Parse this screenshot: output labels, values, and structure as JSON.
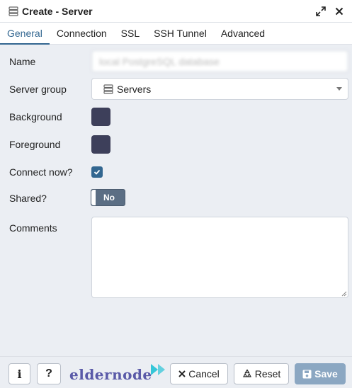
{
  "window": {
    "title": "Create - Server"
  },
  "tabs": [
    {
      "label": "General",
      "active": true
    },
    {
      "label": "Connection",
      "active": false
    },
    {
      "label": "SSL",
      "active": false
    },
    {
      "label": "SSH Tunnel",
      "active": false
    },
    {
      "label": "Advanced",
      "active": false
    }
  ],
  "form": {
    "name": {
      "label": "Name",
      "value": "local PostgreSQL database"
    },
    "server_group": {
      "label": "Server group",
      "value": "Servers"
    },
    "background": {
      "label": "Background",
      "color": "#3d3f5a"
    },
    "foreground": {
      "label": "Foreground",
      "color": "#3d3f5a"
    },
    "connect_now": {
      "label": "Connect now?",
      "checked": true
    },
    "shared": {
      "label": "Shared?",
      "toggle_text": "No"
    },
    "comments": {
      "label": "Comments",
      "value": ""
    }
  },
  "footer": {
    "info_label": "i",
    "help_label": "?",
    "logo_text": "eldernode",
    "cancel_label": "Cancel",
    "reset_label": "Reset",
    "save_label": "Save"
  },
  "colors": {
    "accent": "#326690",
    "save_button": "#8ba7c2",
    "toggle": "#5b6e84",
    "logo": "#5a5aa8",
    "logo_arrow": "#35c6d8"
  },
  "icons": {
    "title": "server-icon",
    "expand": "expand-icon",
    "close": "close-icon",
    "group": "server-icon",
    "cancel": "x-icon",
    "reset": "recycle-icon",
    "save": "floppy-icon"
  }
}
